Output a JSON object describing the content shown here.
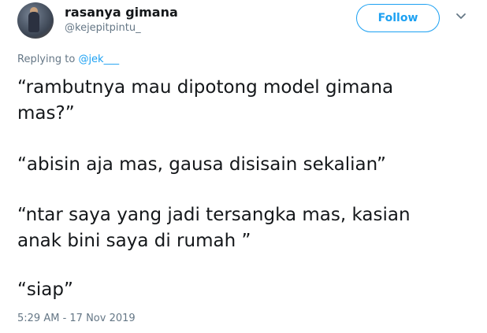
{
  "tweet": {
    "display_name": "rasanya gimana",
    "handle": "@kejepitpintu_",
    "follow_label": "Follow",
    "replying_prefix": "Replying to",
    "replying_mention": "@jek___",
    "lines": [
      "“rambutnya mau dipotong model gimana",
      "mas?”",
      "“abisin aja mas, gausa disisain sekalian”",
      "“ntar saya yang jadi tersangka mas, kasian",
      "anak bini saya di rumah ”",
      "“siap”"
    ],
    "timestamp": "5:29 AM - 17 Nov 2019"
  },
  "icons": {
    "menu": "chevron-down-icon"
  },
  "colors": {
    "accent": "#1da1f2",
    "secondary_text": "#657786",
    "primary_text": "#14171a"
  }
}
